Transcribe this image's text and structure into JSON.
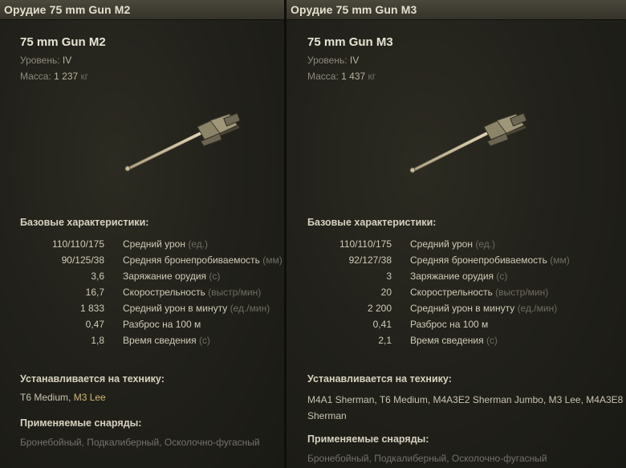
{
  "left": {
    "title": "Орудие 75 mm Gun M2",
    "name": "75 mm Gun M2",
    "tier_label": "Уровень:",
    "tier_value": "IV",
    "mass_label": "Масса:",
    "mass_value": "1 237",
    "mass_unit": "кг",
    "base_header": "Базовые характеристики:",
    "stats": [
      {
        "value": "110/110/175",
        "label": "Средний урон",
        "unit": "(ед.)"
      },
      {
        "value": "90/125/38",
        "label": "Средняя бронепробиваемость",
        "unit": "(мм)"
      },
      {
        "value": "3,6",
        "label": "Заряжание орудия",
        "unit": "(с)"
      },
      {
        "value": "16,7",
        "label": "Скорострельность",
        "unit": "(выстр/мин)"
      },
      {
        "value": "1 833",
        "label": "Средний урон в минуту",
        "unit": "(ед./мин)"
      },
      {
        "value": "0,47",
        "label": "Разброс на 100 м",
        "unit": ""
      },
      {
        "value": "1,8",
        "label": "Время сведения",
        "unit": "(с)"
      }
    ],
    "installed_header": "Устанавливается на технику:",
    "vehicles": [
      {
        "text": "T6 Medium",
        "sep": ", ",
        "highlight": false
      },
      {
        "text": "M3 Lee",
        "sep": "",
        "highlight": true
      }
    ],
    "shells_header": "Применяемые снаряды:",
    "shells": "Бронебойный, Подкалиберный, Осколочно-фугасный"
  },
  "right": {
    "title": "Орудие 75 mm Gun M3",
    "name": "75 mm Gun M3",
    "tier_label": "Уровень:",
    "tier_value": "IV",
    "mass_label": "Масса:",
    "mass_value": "1 437",
    "mass_unit": "кг",
    "base_header": "Базовые характеристики:",
    "stats": [
      {
        "value": "110/110/175",
        "label": "Средний урон",
        "unit": "(ед.)"
      },
      {
        "value": "92/127/38",
        "label": "Средняя бронепробиваемость",
        "unit": "(мм)"
      },
      {
        "value": "3",
        "label": "Заряжание орудия",
        "unit": "(с)"
      },
      {
        "value": "20",
        "label": "Скорострельность",
        "unit": "(выстр/мин)"
      },
      {
        "value": "2 200",
        "label": "Средний урон в минуту",
        "unit": "(ед./мин)"
      },
      {
        "value": "0,41",
        "label": "Разброс на 100 м",
        "unit": ""
      },
      {
        "value": "2,1",
        "label": "Время сведения",
        "unit": "(с)"
      }
    ],
    "installed_header": "Устанавливается на технику:",
    "vehicles_line1": "M4A1 Sherman, T6 Medium, M4A3E2 Sherman Jumbo, M3 Lee, M4A3E8",
    "vehicles_line2": "Sherman",
    "shells_header": "Применяемые снаряды:",
    "shells": "Бронебойный, Подкалиберный, Осколочно-фугасный"
  },
  "colors": {
    "highlight": "#d4b772",
    "background": "#22211b",
    "titlebar": "#3f3d33"
  },
  "icons": [
    "gun-m2-icon",
    "gun-m3-icon"
  ]
}
